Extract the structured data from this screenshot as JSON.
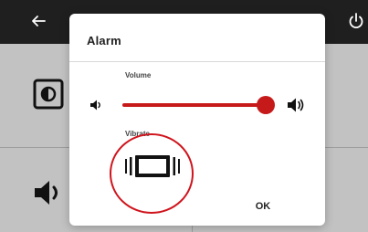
{
  "dialog": {
    "title": "Alarm",
    "volume_label": "Volume",
    "vibrate_label": "Vibrate",
    "ok_label": "OK",
    "volume_level": 0.98
  },
  "colors": {
    "accent": "#c61a1a",
    "topbar": "#1f1f1f",
    "background": "#c2c2c2",
    "dialog": "#ffffff",
    "annotation": "#d0141c"
  },
  "icons": {
    "back": "arrow-left-icon",
    "power": "power-icon",
    "display": "display-brightness-icon",
    "speaker": "speaker-icon",
    "vibrate": "vibrate-phone-icon"
  }
}
